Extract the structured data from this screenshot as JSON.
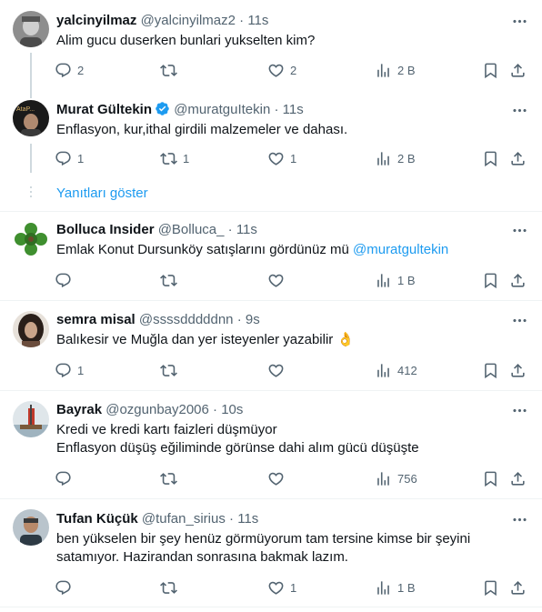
{
  "ui": {
    "show_replies": "Yanıtları göster",
    "accent": "#1d9bf0",
    "muted": "#536471"
  },
  "tweets": [
    {
      "name": "yalcinyilmaz",
      "handle": "@yalcinyilmaz2",
      "time": "11s",
      "text": [
        "Alim gucu duserken bunlari yukselten kim?"
      ],
      "replies": "2",
      "retweets": "",
      "likes": "2",
      "views": "2 B"
    },
    {
      "name": "Murat Gültekin",
      "handle": "@muratguItekin",
      "time": "11s",
      "verified": true,
      "avatar_text": "AtaP...",
      "text": [
        "Enflasyon, kur,ithal girdili malzemeler ve dahası."
      ],
      "replies": "1",
      "retweets": "1",
      "likes": "1",
      "views": "2 B"
    },
    {
      "name": "Bolluca Insider",
      "handle": "@Bolluca_",
      "time": "11s",
      "text_prefix": "Emlak Konut Dursunköy satışlarını gördünüz mü ",
      "mention": "@muratgultekin",
      "replies": "",
      "retweets": "",
      "likes": "",
      "views": "1 B"
    },
    {
      "name": "semra misal",
      "handle": "@ssssdddddnn",
      "time": "9s",
      "text": [
        "Balıkesir ve Muğla dan yer isteyenler yazabilir 👌"
      ],
      "replies": "1",
      "retweets": "",
      "likes": "",
      "views": "412"
    },
    {
      "name": "Bayrak",
      "handle": "@ozgunbay2006",
      "time": "10s",
      "text": [
        "Kredi ve kredi kartı faizleri düşmüyor",
        "Enflasyon düşüş eğiliminde görünse dahi alım gücü düşüşte"
      ],
      "replies": "",
      "retweets": "",
      "likes": "",
      "views": "756"
    },
    {
      "name": "Tufan Küçük",
      "handle": "@tufan_sirius",
      "time": "11s",
      "text": [
        "ben yükselen bir şey henüz görmüyorum tam tersine kimse bir şeyini",
        "satamıyor. Hazirandan sonrasına bakmak lazım."
      ],
      "replies": "",
      "retweets": "",
      "likes": "1",
      "views": "1 B"
    }
  ]
}
